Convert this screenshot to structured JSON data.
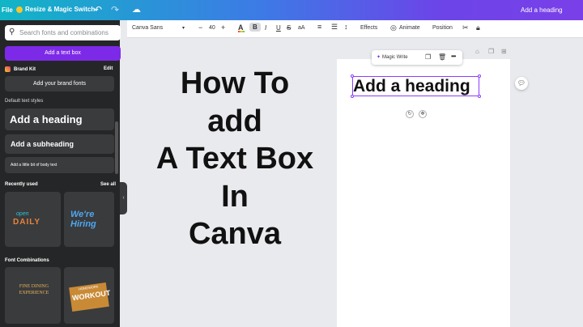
{
  "header": {
    "file_label": "File",
    "resize_label": "Resize & Magic Switch",
    "undo_icon": "undo-icon",
    "redo_icon": "redo-icon",
    "cloud_icon": "cloud-sync-icon",
    "doc_title": "Add a heading"
  },
  "panel": {
    "search_placeholder": "Search fonts and combinations",
    "add_text_box": "Add a text box",
    "brand_kit": "Brand Kit",
    "edit": "Edit",
    "add_brand_fonts": "Add your brand fonts",
    "default_styles_label": "Default text styles",
    "heading": "Add a heading",
    "subheading": "Add a subheading",
    "body": "Add a little bit of body text",
    "recently_used": "Recently used",
    "see_all": "See all",
    "recent_thumbs": [
      {
        "line1": "open",
        "line2": "DAILY"
      },
      {
        "line1": "We're",
        "line2": "Hiring"
      }
    ],
    "font_combinations": "Font Combinations",
    "combo_thumbs": [
      {
        "text": "FINE DINING EXPERIENCE"
      },
      {
        "small": "HOMEWORK",
        "text": "WORKOUT"
      }
    ]
  },
  "toolbar": {
    "font_name": "Canva Sans",
    "font_size": "40",
    "minus": "−",
    "plus": "+",
    "color_label": "A",
    "bold": "B",
    "italic": "I",
    "underline": "U",
    "strike": "S",
    "case": "aA",
    "effects": "Effects",
    "animate": "Animate",
    "position": "Position"
  },
  "overlay": {
    "lines": [
      "How To",
      "add",
      "A Text Box",
      "In",
      "Canva"
    ]
  },
  "canvas": {
    "context_menu": {
      "magic_write": "Magic Write"
    },
    "heading_text": "Add a heading"
  },
  "colors": {
    "accent": "#7d2ae8",
    "panel_bg": "#252627",
    "selection": "#8b3dff"
  }
}
